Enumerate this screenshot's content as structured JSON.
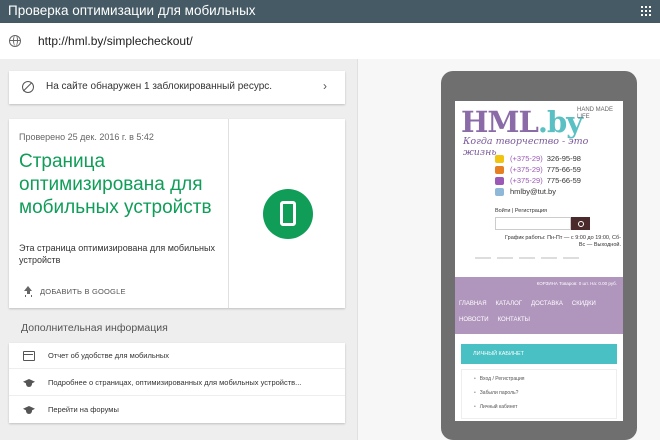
{
  "topbar": {
    "title": "Проверка оптимизации для мобильных",
    "apps_icon": "apps-grid-icon"
  },
  "urlbar": {
    "url": "http://hml.by/simplecheckout/"
  },
  "blocked": {
    "text": "На сайте обнаружен 1 заблокированный ресурс.",
    "chevron": "›"
  },
  "result": {
    "date": "Проверено 25 дек. 2016 г. в 5:42",
    "headline": "Страница оптимизирована для мобильных устройств",
    "subtext": "Эта страница оптимизирована для мобильных устройств",
    "share_label": "ДОБАВИТЬ В GOOGLE",
    "accent_color": "#0f9d58"
  },
  "more_info": {
    "title": "Дополнительная информация",
    "items": [
      {
        "label": "Отчет об удобстве для мобильных",
        "icon": "report-icon"
      },
      {
        "label": "Подробнее о страницах, оптимизированных для мобильных устройств...",
        "icon": "graduation-cap-icon"
      },
      {
        "label": "Перейти на форумы",
        "icon": "graduation-cap-icon"
      }
    ]
  },
  "preview": {
    "logo": "HML",
    "logo_suffix": ".by",
    "logo_tag": "HAND MADE LIFE",
    "slogan": "Когда творчество - это жизнь",
    "phones": [
      {
        "code": "(+375-29)",
        "number": "326-95-98",
        "color": "#f1c40f"
      },
      {
        "code": "(+375-29)",
        "number": "775-66-59",
        "color": "#e67e22"
      },
      {
        "code": "(+375-29)",
        "number": "775-66-59",
        "color": "#9b59b6"
      }
    ],
    "email": "hmlby@tut.by",
    "login": "Войти | Регистрация",
    "hours": "График работы: Пн-Пт — с 9:00 до 19:00, Сб-Вс — Выходной.",
    "cart": "КОРЗИНА  Товаров: 0 шт. На: 0.00 руб.",
    "menu": [
      "ГЛАВНАЯ",
      "КАТАЛОГ",
      "ДОСТАВКА",
      "СКИДКИ",
      "НОВОСТИ",
      "КОНТАКТЫ"
    ],
    "cabinet": "ЛИЧНЫЙ КАБИНЕТ",
    "side_items": [
      "Вход / Регистрация",
      "Забыли пароль?",
      "Личный кабинет"
    ]
  }
}
